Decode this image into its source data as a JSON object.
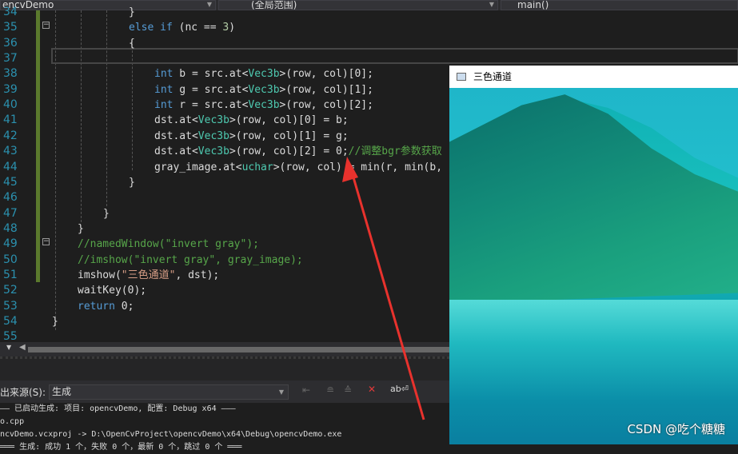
{
  "toolbar": {
    "project": "encvDemo",
    "scope": "(全局范围)",
    "function": "main()"
  },
  "code": [
    {
      "n": "34",
      "t": [
        [
          "",
          "}"
        ]
      ],
      "i": 3
    },
    {
      "n": "35",
      "t": [
        [
          "kw",
          "else if"
        ],
        [
          "",
          " (nc == "
        ],
        [
          "num",
          "3"
        ],
        [
          "",
          ")"
        ]
      ],
      "i": 3
    },
    {
      "n": "36",
      "t": [
        [
          "",
          "{"
        ]
      ],
      "i": 3
    },
    {
      "n": "37",
      "t": [],
      "i": 3
    },
    {
      "n": "38",
      "t": [
        [
          "kw",
          "int"
        ],
        [
          "",
          " b = src.at<"
        ],
        [
          "ty",
          "Vec3b"
        ],
        [
          "",
          ">(row, col)[0];"
        ]
      ],
      "i": 4
    },
    {
      "n": "39",
      "t": [
        [
          "kw",
          "int"
        ],
        [
          "",
          " g = src.at<"
        ],
        [
          "ty",
          "Vec3b"
        ],
        [
          "",
          ">(row, col)[1];"
        ]
      ],
      "i": 4
    },
    {
      "n": "40",
      "t": [
        [
          "kw",
          "int"
        ],
        [
          "",
          " r = src.at<"
        ],
        [
          "ty",
          "Vec3b"
        ],
        [
          "",
          ">(row, col)[2];"
        ]
      ],
      "i": 4
    },
    {
      "n": "41",
      "t": [
        [
          "",
          "dst.at<"
        ],
        [
          "ty",
          "Vec3b"
        ],
        [
          "",
          ">(row, col)[0] = b;"
        ]
      ],
      "i": 4
    },
    {
      "n": "42",
      "t": [
        [
          "",
          "dst.at<"
        ],
        [
          "ty",
          "Vec3b"
        ],
        [
          "",
          ">(row, col)[1] = g;"
        ]
      ],
      "i": 4
    },
    {
      "n": "43",
      "t": [
        [
          "",
          "dst.at<"
        ],
        [
          "ty",
          "Vec3b"
        ],
        [
          "",
          ">(row, col)[2] = 0;"
        ],
        [
          "cm",
          "//调整bgr参数获取"
        ]
      ],
      "i": 4
    },
    {
      "n": "44",
      "t": [
        [
          "",
          "gray_image.at<"
        ],
        [
          "ty",
          "uchar"
        ],
        [
          "",
          ">(row, col) = min(r, min(b,"
        ]
      ],
      "i": 4
    },
    {
      "n": "45",
      "t": [
        [
          "",
          "}"
        ]
      ],
      "i": 3
    },
    {
      "n": "46",
      "t": [],
      "i": 3
    },
    {
      "n": "47",
      "t": [
        [
          "",
          "}"
        ]
      ],
      "i": 2
    },
    {
      "n": "48",
      "t": [
        [
          "",
          "}"
        ]
      ],
      "i": 1
    },
    {
      "n": "49",
      "t": [
        [
          "cm",
          "//namedWindow(\"invert gray\");"
        ]
      ],
      "i": 1
    },
    {
      "n": "50",
      "t": [
        [
          "cm",
          "//imshow(\"invert gray\", gray_image);"
        ]
      ],
      "i": 1
    },
    {
      "n": "51",
      "t": [
        [
          "",
          "imshow("
        ],
        [
          "st",
          "\"三色通道\""
        ],
        [
          "",
          ", dst);"
        ]
      ],
      "i": 1
    },
    {
      "n": "52",
      "t": [
        [
          "",
          "waitKey(0);"
        ]
      ],
      "i": 1
    },
    {
      "n": "53",
      "t": [
        [
          "kw",
          "return"
        ],
        [
          "",
          " 0;"
        ]
      ],
      "i": 1
    },
    {
      "n": "54",
      "t": [
        [
          "",
          "}"
        ]
      ],
      "i": 0
    },
    {
      "n": "55",
      "t": [],
      "i": 0
    }
  ],
  "output": {
    "source_label": "出来源(S):",
    "source_value": "生成",
    "lines": [
      "—— 已启动生成: 项目: opencvDemo, 配置: Debug x64 ———",
      "o.cpp",
      "ncvDemo.vcxproj -> D:\\OpenCvProject\\opencvDemo\\x64\\Debug\\opencvDemo.exe",
      "═══ 生成: 成功 1 个，失败 0 个，最新 0 个，跳过 0 个 ═══"
    ]
  },
  "image_window": {
    "title": "三色通道"
  },
  "watermark": "CSDN @吃个糖糖",
  "colors": {
    "annotation_arrow": "#e8322d",
    "gutter_changed": "#5b7a2d"
  }
}
